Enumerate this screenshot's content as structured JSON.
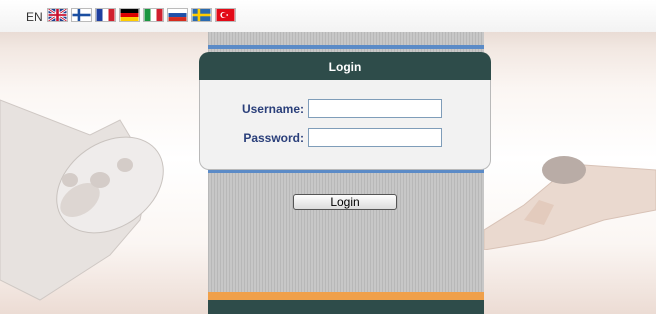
{
  "header": {
    "language_code": "EN",
    "flags": [
      "uk-flag-icon",
      "finland-flag-icon",
      "france-flag-icon",
      "germany-flag-icon",
      "italy-flag-icon",
      "russia-flag-icon",
      "sweden-flag-icon",
      "turkey-flag-icon"
    ]
  },
  "login_panel": {
    "title": "Login",
    "username_label": "Username:",
    "username_value": "",
    "password_label": "Password:",
    "password_value": "",
    "submit_label": "Login"
  },
  "colors": {
    "panel_header": "#2e4c4a",
    "label_text": "#2a3f7a",
    "accent_blue": "#5b8bc7",
    "accent_orange": "#f0a04a"
  }
}
